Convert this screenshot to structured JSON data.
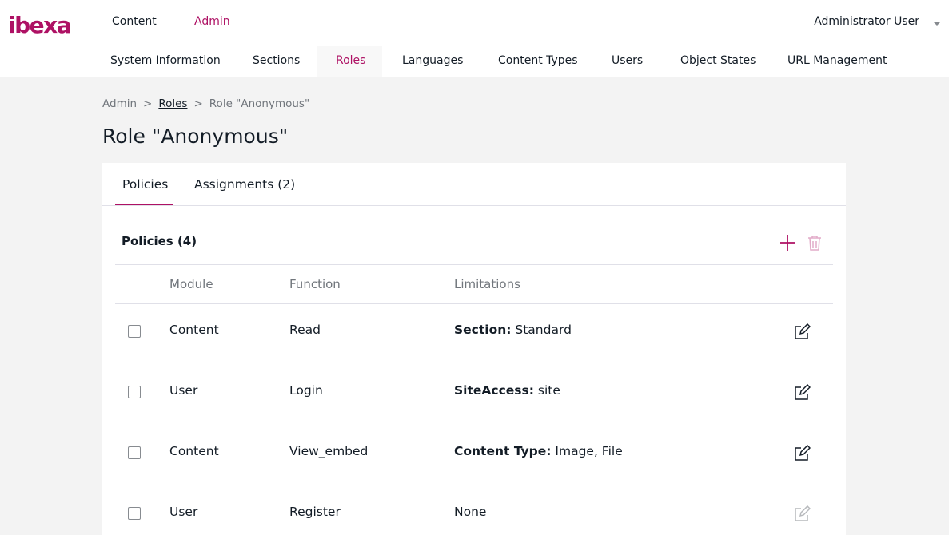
{
  "topbar": {
    "logo_text": "ibexa",
    "nav": [
      "Content",
      "Admin"
    ],
    "user": "Administrator User"
  },
  "subnav": [
    "System Information",
    "Sections",
    "Roles",
    "Languages",
    "Content Types",
    "Users",
    "Object States",
    "URL Management"
  ],
  "breadcrumb": {
    "root": "Admin",
    "sep": ">",
    "parent": "Roles",
    "current": "Role \"Anonymous\""
  },
  "page_title": "Role \"Anonymous\"",
  "tabs": [
    "Policies",
    "Assignments (2)"
  ],
  "policies": {
    "title": "Policies (4)",
    "columns": [
      "Module",
      "Function",
      "Limitations"
    ],
    "rows": [
      {
        "module": "Content",
        "function": "Read",
        "limit_key": "Section:",
        "limit_val": " Standard"
      },
      {
        "module": "User",
        "function": "Login",
        "limit_key": "SiteAccess:",
        "limit_val": " site"
      },
      {
        "module": "Content",
        "function": "View_embed",
        "limit_key": "Content Type:",
        "limit_val": " Image, File"
      },
      {
        "module": "User",
        "function": "Register",
        "limit_key": "",
        "limit_val": "None"
      }
    ]
  },
  "colors": {
    "accent": "#ae1164",
    "text": "#131c26",
    "muted": "#71767c",
    "background": "#f3f3f3"
  },
  "icons": [
    "ibexa-logo",
    "chevron-down-icon",
    "plus-icon",
    "trash-icon",
    "edit-icon"
  ]
}
